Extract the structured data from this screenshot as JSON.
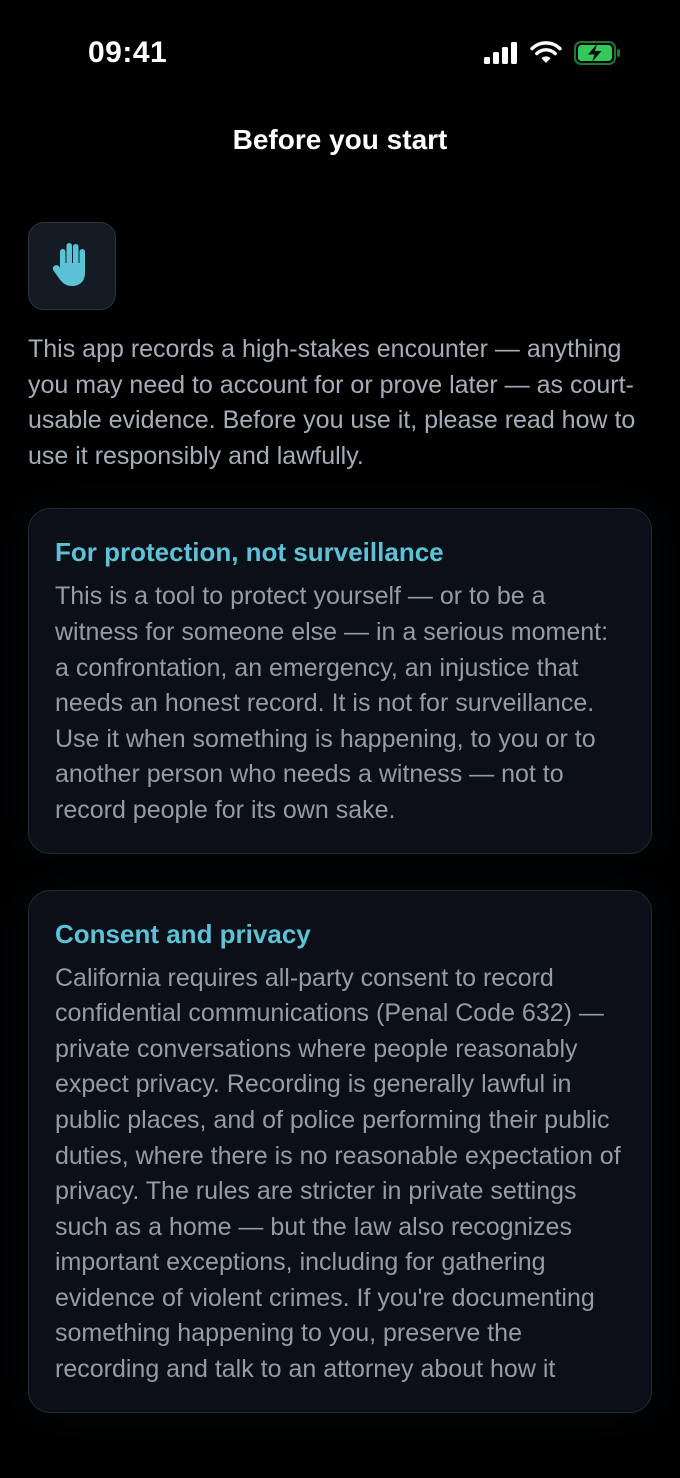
{
  "status_bar": {
    "time": "09:41",
    "icons": [
      "signal-icon",
      "wifi-icon",
      "battery-charging-icon"
    ]
  },
  "header": {
    "title": "Before you start"
  },
  "hero": {
    "icon": "hand-raised-icon",
    "accent": "#5cc2d6"
  },
  "intro": {
    "text": "This app records a high-stakes encounter — anything you may need to account for or prove later — as court-usable evidence. Before you use it, please read how to use it responsibly and lawfully."
  },
  "sections": [
    {
      "title": "For protection, not surveillance",
      "body": "This is a tool to protect yourself — or to be a witness for someone else — in a serious moment: a confrontation, an emergency, an injustice that needs an honest record. It is not for surveillance. Use it when something is happening, to you or to another person who needs a witness — not to record people for its own sake."
    },
    {
      "title": "Consent and privacy",
      "body": "California requires all-party consent to record confidential communications (Penal Code 632) — private conversations where people reasonably expect privacy. Recording is generally lawful in public places, and of police performing their public duties, where there is no reasonable expectation of privacy. The rules are stricter in private settings such as a home — but the law also recognizes important exceptions, including for gathering evidence of violent crimes. If you're documenting something happening to you, preserve the recording and talk to an attorney about how it"
    }
  ],
  "colors": {
    "background": "#000000",
    "card": "#0b0f17",
    "accent": "#5cc2d6",
    "battery": "#34c759"
  }
}
